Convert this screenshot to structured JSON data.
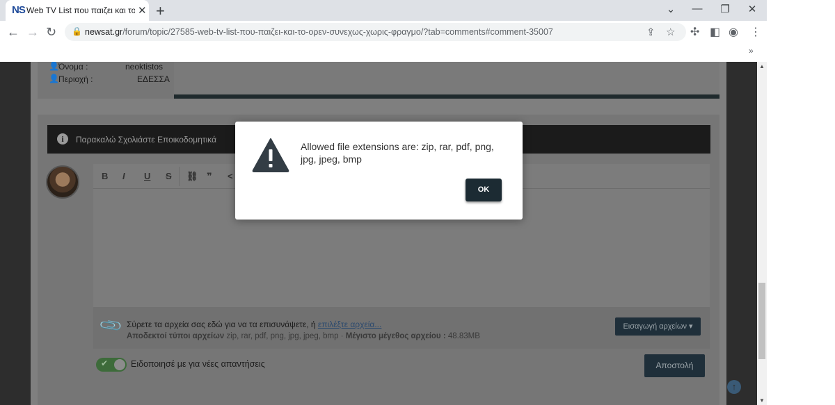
{
  "browser": {
    "tab": {
      "favicon": "NS",
      "title": "Web TV List που παιζει και το Ο"
    },
    "url": {
      "domain": "newsat.gr",
      "path": "/forum/topic/27585-web-tv-list-που-παιζει-και-το-ορεν-συνεχως-χωρις-φραγμο/?tab=comments#comment-35007"
    }
  },
  "profile": {
    "name_label": "Όνομα :",
    "name_value": "neoktistos",
    "area_label": "Περιοχή :",
    "area_value": "ΕΔΕΣΣΑ"
  },
  "notice": {
    "text": "Παρακαλώ Σχολιάστε Εποικοδομητικά"
  },
  "editor": {
    "toolbar": [
      "B",
      "I",
      "U",
      "S",
      "⛓",
      "❞",
      "<"
    ]
  },
  "attachments": {
    "drop_text": "Σύρετε τα αρχεία σας εδώ για να τα επισυνάψετε, ή ",
    "choose_link": "επιλέξτε αρχεία...",
    "allowed_label": "Αποδεκτοί τύποι αρχείων",
    "allowed_types": " zip, rar, pdf, png, jpg, jpeg, bmp · ",
    "max_size_label": "Μέγιστο μέγεθος αρχείου :",
    "max_size_value": " 48.83MB",
    "insert_button": "Εισαγωγή αρχείων ▾"
  },
  "notify": {
    "label": "Ειδοποιησέ με για νέες απαντήσεις",
    "enabled": true
  },
  "submit_button": "Αποστολή",
  "modal": {
    "message": "Allowed file extensions are: zip, rar, pdf, png, jpg, jpeg, bmp",
    "ok_label": "OK"
  },
  "colors": {
    "modal_button": "#1c2b33",
    "notice_bar": "#1b1b1b",
    "page_overlay": "#7f7f7f"
  }
}
